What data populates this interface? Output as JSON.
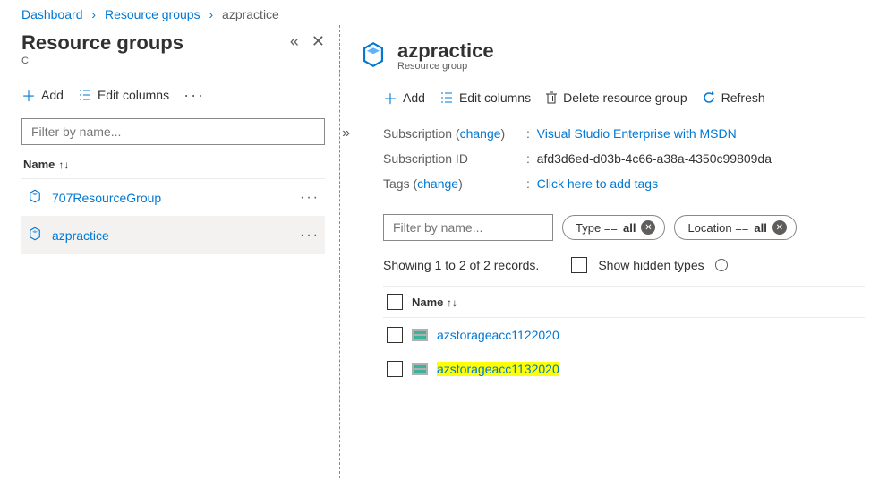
{
  "breadcrumb": {
    "items": [
      "Dashboard",
      "Resource groups",
      "azpractice"
    ]
  },
  "left": {
    "title": "Resource groups",
    "subtitle": "C",
    "toolbar": {
      "add": "Add",
      "edit": "Edit columns"
    },
    "filter_placeholder": "Filter by name...",
    "column": "Name",
    "items": [
      {
        "name": "707ResourceGroup"
      },
      {
        "name": "azpractice"
      }
    ]
  },
  "right": {
    "title": "azpractice",
    "subtitle": "Resource group",
    "toolbar": {
      "add": "Add",
      "edit": "Edit columns",
      "delete": "Delete resource group",
      "refresh": "Refresh"
    },
    "kv": {
      "sub_label": "Subscription",
      "change": "change",
      "sub_value": "Visual Studio Enterprise with MSDN",
      "subid_label": "Subscription ID",
      "subid_value": "afd3d6ed-d03b-4c66-a38a-4350c99809da",
      "tags_label": "Tags",
      "tags_value": "Click here to add tags"
    },
    "filters": {
      "placeholder": "Filter by name...",
      "type_prefix": "Type == ",
      "type_value": "all",
      "loc_prefix": "Location == ",
      "loc_value": "all"
    },
    "records": {
      "text": "Showing 1 to 2 of 2 records.",
      "hidden": "Show hidden types"
    },
    "table": {
      "column": "Name",
      "rows": [
        {
          "name": "azstorageacc1122020",
          "highlight": false
        },
        {
          "name": "azstorageacc1132020",
          "highlight": true
        }
      ]
    }
  }
}
